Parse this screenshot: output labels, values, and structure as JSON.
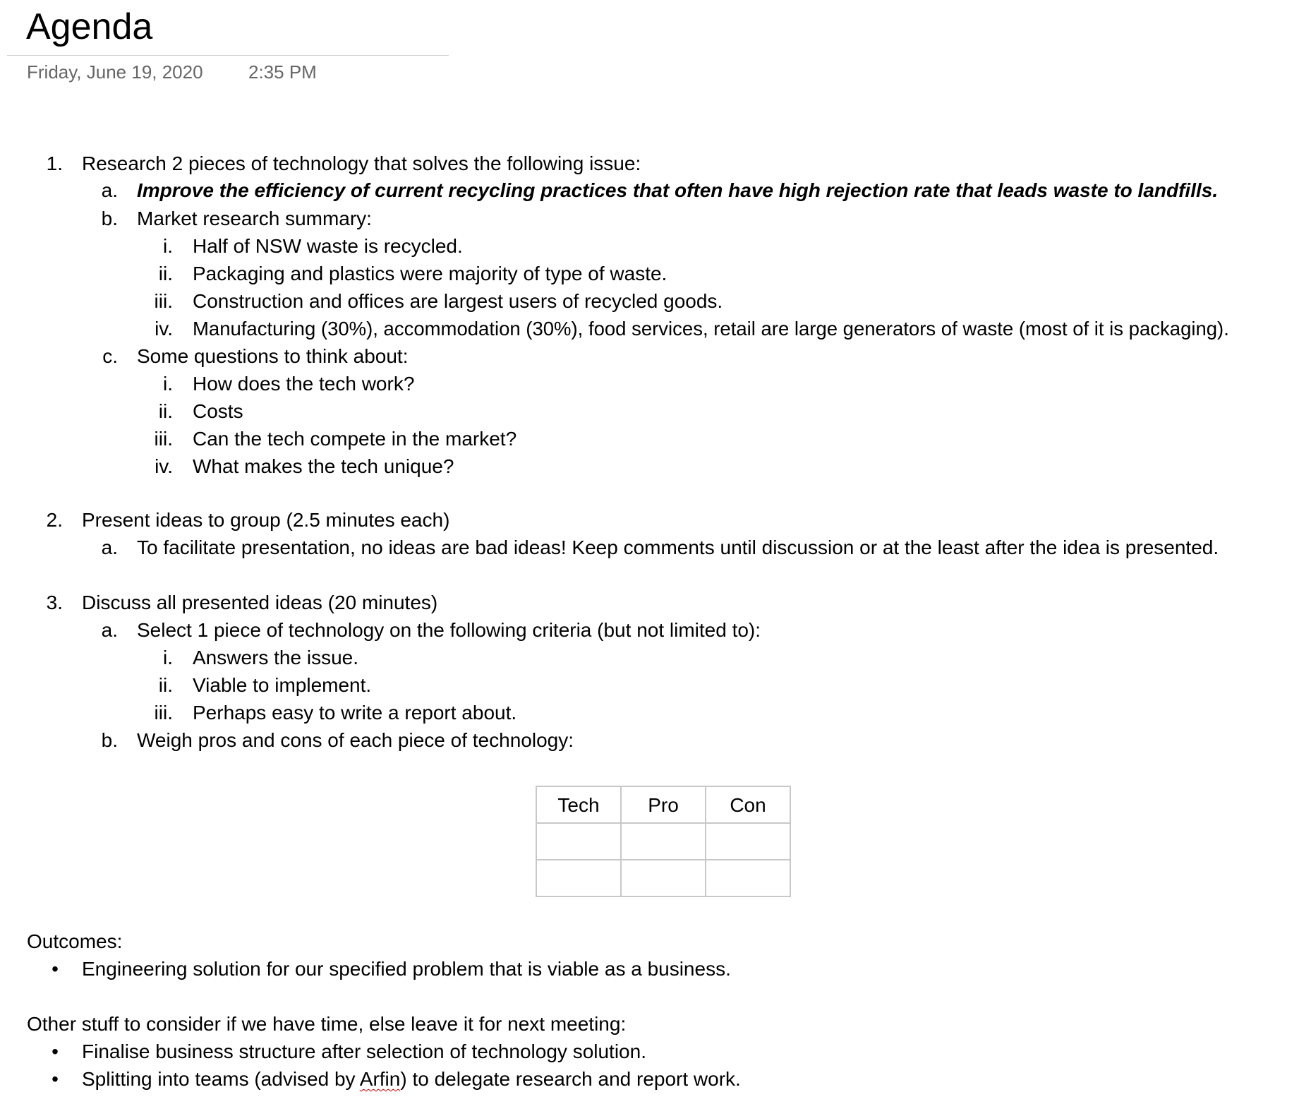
{
  "page": {
    "title": "Agenda",
    "date": "Friday, June 19, 2020",
    "time": "2:35 PM"
  },
  "agenda": {
    "item1": {
      "marker": "1.",
      "text": "Research 2 pieces of technology that solves the following issue:",
      "a": {
        "marker": "a.",
        "text": "Improve the efficiency of current recycling practices that often have high rejection rate that leads waste to landfills."
      },
      "b": {
        "marker": "b.",
        "text": "Market research summary:",
        "items": [
          {
            "marker": "i.",
            "text": "Half of NSW waste is recycled."
          },
          {
            "marker": "ii.",
            "text": "Packaging and plastics were majority of type of waste."
          },
          {
            "marker": "iii.",
            "text": "Construction and offices are largest users of recycled goods."
          },
          {
            "marker": "iv.",
            "text": "Manufacturing (30%), accommodation (30%), food services, retail are large generators of waste (most of it is packaging)."
          }
        ]
      },
      "c": {
        "marker": "c.",
        "text": "Some questions to think about:",
        "items": [
          {
            "marker": "i.",
            "text": "How does the tech work?"
          },
          {
            "marker": "ii.",
            "text": "Costs"
          },
          {
            "marker": "iii.",
            "text": "Can the tech compete in the market?"
          },
          {
            "marker": "iv.",
            "text": "What makes the tech unique?"
          }
        ]
      }
    },
    "item2": {
      "marker": "2.",
      "text": "Present ideas to group (2.5 minutes each)",
      "a": {
        "marker": "a.",
        "text": "To facilitate presentation, no ideas are bad ideas! Keep comments until discussion or at the least after the idea is presented."
      }
    },
    "item3": {
      "marker": "3.",
      "text": "Discuss all presented ideas (20 minutes)",
      "a": {
        "marker": "a.",
        "text": "Select 1 piece of technology on the following criteria (but not limited to):",
        "items": [
          {
            "marker": "i.",
            "text": "Answers the issue."
          },
          {
            "marker": "ii.",
            "text": "Viable to implement."
          },
          {
            "marker": "iii.",
            "text": "Perhaps easy to write a report about."
          }
        ]
      },
      "b": {
        "marker": "b.",
        "text": "Weigh pros and cons of each piece of technology:"
      }
    }
  },
  "table": {
    "headers": [
      "Tech",
      "Pro",
      "Con"
    ],
    "rows": [
      [
        "",
        "",
        ""
      ],
      [
        "",
        "",
        ""
      ]
    ]
  },
  "outcomes": {
    "heading": "Outcomes:",
    "bullet": "•",
    "items": [
      "Engineering solution for our specified problem that is viable as a business."
    ]
  },
  "other": {
    "heading": "Other stuff to consider if we have time, else leave it for next meeting:",
    "bullet": "•",
    "item1": "Finalise business structure after selection of technology solution.",
    "item2_before": "Splitting into teams (advised by ",
    "item2_name": "Arfin",
    "item2_after": ") to delegate research and report work."
  }
}
